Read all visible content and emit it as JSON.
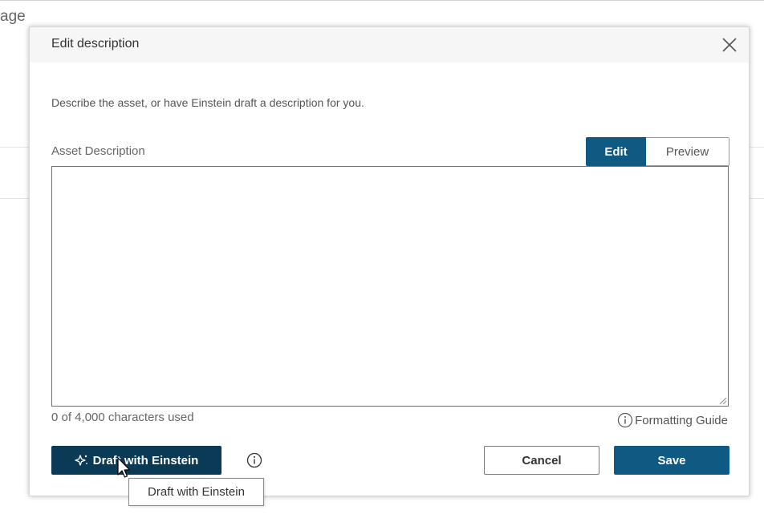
{
  "background": {
    "page_label": "age"
  },
  "dialog": {
    "title": "Edit description",
    "close_icon": "close-icon",
    "instructions": "Describe the asset, or have Einstein draft a description for you.",
    "field_label": "Asset Description",
    "tabs": [
      {
        "label": "Edit",
        "selected": true
      },
      {
        "label": "Preview",
        "selected": false
      }
    ],
    "description_value": "",
    "char_count": "0 of 4,000 characters used",
    "formatting_guide": "Formatting Guide",
    "draft_button": "Draft with Einstein",
    "draft_icon": "sparkle-icon",
    "info_icon": "info-icon",
    "cancel_button": "Cancel",
    "save_button": "Save",
    "tooltip": "Draft with Einstein"
  },
  "colors": {
    "primary": "#0e5a82",
    "draft_button": "#0b3a57",
    "header_bg": "#f6f6f6"
  }
}
